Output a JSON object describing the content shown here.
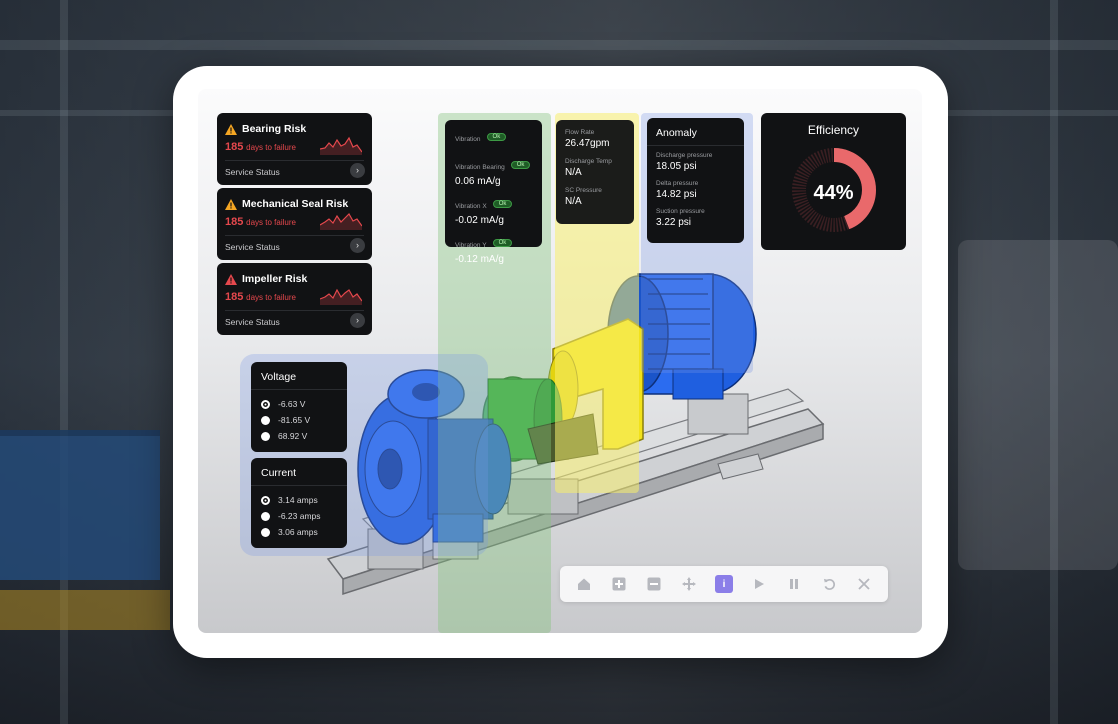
{
  "risk_cards": [
    {
      "title": "Bearing Risk",
      "days": "185",
      "days_suffix": "days to failure",
      "status": "Service Status"
    },
    {
      "title": "Mechanical Seal Risk",
      "days": "185",
      "days_suffix": "days to failure",
      "status": "Service Status"
    },
    {
      "title": "Impeller Risk",
      "days": "185",
      "days_suffix": "days to failure",
      "status": "Service Status"
    }
  ],
  "vibration": {
    "items": [
      {
        "label": "Vibration",
        "pill": "Ok",
        "value": ""
      },
      {
        "label": "Vibration Bearing",
        "pill": "Ok",
        "value": "0.06 mA/g"
      },
      {
        "label": "Vibration X",
        "pill": "Ok",
        "value": "-0.02 mA/g"
      },
      {
        "label": "Vibration Y",
        "pill": "Ok",
        "value": "-0.12 mA/g"
      }
    ]
  },
  "flow": {
    "items": [
      {
        "label": "Flow Rate",
        "value": "26.47gpm"
      },
      {
        "label": "Discharge Temp",
        "value": "N/A"
      },
      {
        "label": "SC Pressure",
        "value": "N/A"
      }
    ]
  },
  "anomaly": {
    "title": "Anomaly",
    "items": [
      {
        "label": "Discharge pressure",
        "value": "18.05 psi"
      },
      {
        "label": "Delta pressure",
        "value": "14.82 psi"
      },
      {
        "label": "Suction pressure",
        "value": "3.22 psi"
      }
    ]
  },
  "efficiency": {
    "title": "Efficiency",
    "label": "44%",
    "value": 0.44
  },
  "voltage": {
    "title": "Voltage",
    "options": [
      "-6.63 V",
      "-81.65 V",
      "68.92 V"
    ],
    "selected": 0
  },
  "current": {
    "title": "Current",
    "options": [
      "3.14 amps",
      "-6.23 amps",
      "3.06 amps"
    ],
    "selected": 0
  },
  "toolbar": {
    "buttons": [
      {
        "name": "home-button",
        "icon": "home-icon"
      },
      {
        "name": "zoom-in-button",
        "icon": "plus-icon"
      },
      {
        "name": "zoom-out-button",
        "icon": "minus-icon"
      },
      {
        "name": "move-button",
        "icon": "move-icon"
      },
      {
        "name": "info-button",
        "icon": "info-icon",
        "active": true
      },
      {
        "name": "play-button",
        "icon": "play-icon"
      },
      {
        "name": "pause-button",
        "icon": "pause-icon"
      },
      {
        "name": "reset-button",
        "icon": "reset-icon"
      },
      {
        "name": "close-button",
        "icon": "close-icon"
      }
    ]
  },
  "colors": {
    "accent": "#8b7ee8",
    "risk_red": "#e5484d",
    "ok_green": "#3d9a45",
    "pump_blue": "#1f5fe0",
    "coupling_yellow": "#f2e21a"
  }
}
